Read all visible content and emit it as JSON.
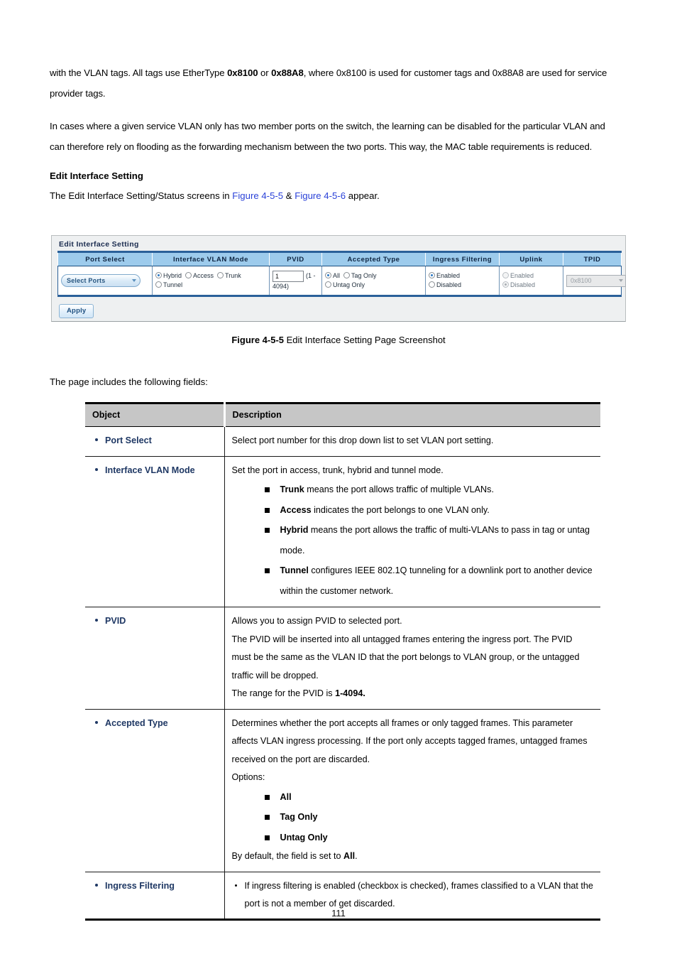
{
  "document": {
    "page_number": "111"
  },
  "body": {
    "para1_pre": "with the VLAN tags. All tags use EtherType ",
    "para1_b1": "0x8100",
    "para1_mid": " or ",
    "para1_b2": "0x88A8",
    "para1_post": ", where 0x8100 is used for customer tags and 0x88A8 are used for service provider tags.",
    "para2": "In cases where a given service VLAN only has two member ports on the switch, the learning can be disabled for the particular VLAN and can therefore rely on flooding as the forwarding mechanism between the two ports. This way, the MAC table requirements is reduced.",
    "section_heading": "Edit Interface Setting",
    "intro_pre": "The Edit Interface Setting/Status screens in ",
    "intro_ref1": "Figure 4-5-5",
    "intro_amp": " & ",
    "intro_ref2": "Figure 4-5-6",
    "intro_post": " appear.",
    "fields_intro": "The page includes the following fields:"
  },
  "figure": {
    "caption_bold": "Figure 4-5-5",
    "caption_rest": " Edit Interface Setting Page Screenshot"
  },
  "ui_screenshot": {
    "panel_title": "Edit Interface Setting",
    "columns": [
      "Port Select",
      "Interface VLAN Mode",
      "PVID",
      "Accepted Type",
      "Ingress Filtering",
      "Uplink",
      "TPID"
    ],
    "port_select": {
      "value": "Select Ports",
      "caret": "chevron-down-icon"
    },
    "interface_vlan_mode": {
      "options": [
        "Hybrid",
        "Access",
        "Trunk",
        "Tunnel"
      ],
      "selected": "Hybrid"
    },
    "pvid": {
      "value": "1",
      "hint": "(1 - 4094)"
    },
    "accepted_type": {
      "options": [
        "All",
        "Tag Only",
        "Untag Only"
      ],
      "selected": "All"
    },
    "ingress_filtering": {
      "options": [
        "Enabled",
        "Disabled"
      ],
      "selected": "Enabled"
    },
    "uplink": {
      "options": [
        "Enabled",
        "Disabled"
      ],
      "selected": "Disabled",
      "disabled": true
    },
    "tpid": {
      "value": "0x8100",
      "disabled": true
    },
    "apply_label": "Apply"
  },
  "desc_table": {
    "headers": {
      "object": "Object",
      "description": "Description"
    },
    "rows": [
      {
        "object": "Port Select",
        "lines": [
          "Select port number for this drop down list to set VLAN port setting."
        ]
      },
      {
        "object": "Interface VLAN Mode",
        "lines": [
          "Set the port in access, trunk, hybrid and tunnel mode."
        ],
        "bullets": [
          {
            "term": "Trunk",
            "text": " means the port allows traffic of multiple VLANs."
          },
          {
            "term": "Access",
            "text": " indicates the port belongs to one VLAN only."
          },
          {
            "term": "Hybrid",
            "text": " means the port allows the traffic of multi-VLANs to pass in tag or untag mode."
          },
          {
            "term": "Tunnel",
            "text": " configures IEEE 802.1Q tunneling for a downlink port to another device within the customer network."
          }
        ]
      },
      {
        "object": "PVID",
        "lines": [
          "Allows you to assign PVID to selected port.",
          "The PVID will be inserted into all untagged frames entering the ingress port. The PVID must be the same as the VLAN ID that the port belongs to VLAN group, or the untagged traffic will be dropped."
        ],
        "range_pre": "The range for the PVID is ",
        "range_bold": "1-4094."
      },
      {
        "object": "Accepted Type",
        "lines": [
          "Determines whether the port accepts all frames or only tagged frames. This parameter affects VLAN ingress processing. If the port only accepts tagged frames, untagged frames received on the port are discarded.",
          "Options:"
        ],
        "bullets": [
          {
            "term": "All",
            "text": ""
          },
          {
            "term": "Tag Only",
            "text": ""
          },
          {
            "term": "Untag Only",
            "text": ""
          }
        ],
        "default_pre": "By default, the field is set to ",
        "default_bold": "All",
        "default_post": "."
      },
      {
        "object": "Ingress Filtering",
        "round_bullets": [
          "If ingress filtering is enabled (checkbox is checked), frames classified to a VLAN that the port is not a member of get discarded."
        ]
      }
    ]
  }
}
